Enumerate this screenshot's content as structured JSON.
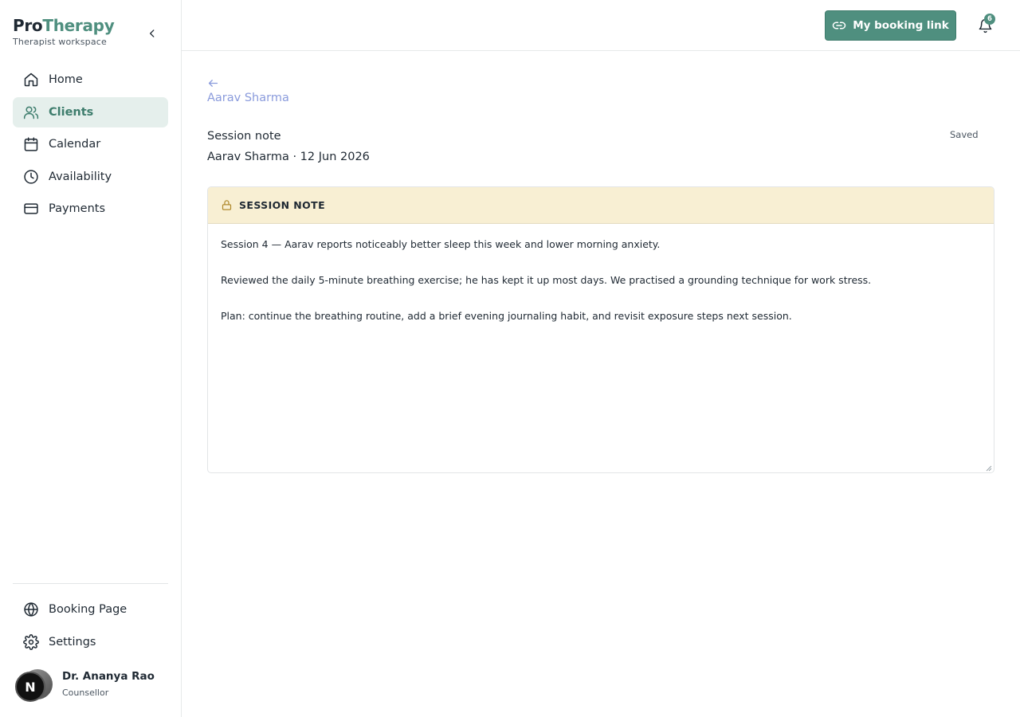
{
  "brand": {
    "name_part1": "Pro",
    "name_part2": "Therapy",
    "subtitle": "Therapist workspace"
  },
  "sidebar": {
    "items": [
      {
        "label": "Home",
        "icon": "home-icon",
        "active": false
      },
      {
        "label": "Clients",
        "icon": "users-icon",
        "active": true
      },
      {
        "label": "Calendar",
        "icon": "calendar-icon",
        "active": false
      },
      {
        "label": "Availability",
        "icon": "clock-icon",
        "active": false
      },
      {
        "label": "Payments",
        "icon": "credit-card-icon",
        "active": false
      }
    ],
    "bottom_items": [
      {
        "label": "Booking Page",
        "icon": "globe-icon"
      },
      {
        "label": "Settings",
        "icon": "gear-icon"
      }
    ],
    "profile": {
      "avatar_letter": "N",
      "name": "Dr. Ananya Rao",
      "role": "Counsellor"
    }
  },
  "topbar": {
    "booking_button": "My booking link",
    "notification_count": "6"
  },
  "main": {
    "back_label": "Aarav Sharma",
    "title": "Session note",
    "subtitle": "Aarav Sharma · 12 Jun 2026",
    "save_status": "Saved",
    "note": {
      "header": "SESSION NOTE",
      "paragraphs": [
        "Session 4 — Aarav reports noticeably better sleep this week and lower morning anxiety.",
        "Reviewed the daily 5-minute breathing exercise; he has kept it up most days. We practised a grounding technique for work stress.",
        "Plan: continue the breathing routine, add a brief evening journaling habit, and revisit exposure steps next session."
      ]
    }
  },
  "colors": {
    "accent": "#4f8f7f",
    "active_bg": "#e5efec",
    "note_header_bg": "#f8efd3",
    "link": "#8a9bdc"
  }
}
